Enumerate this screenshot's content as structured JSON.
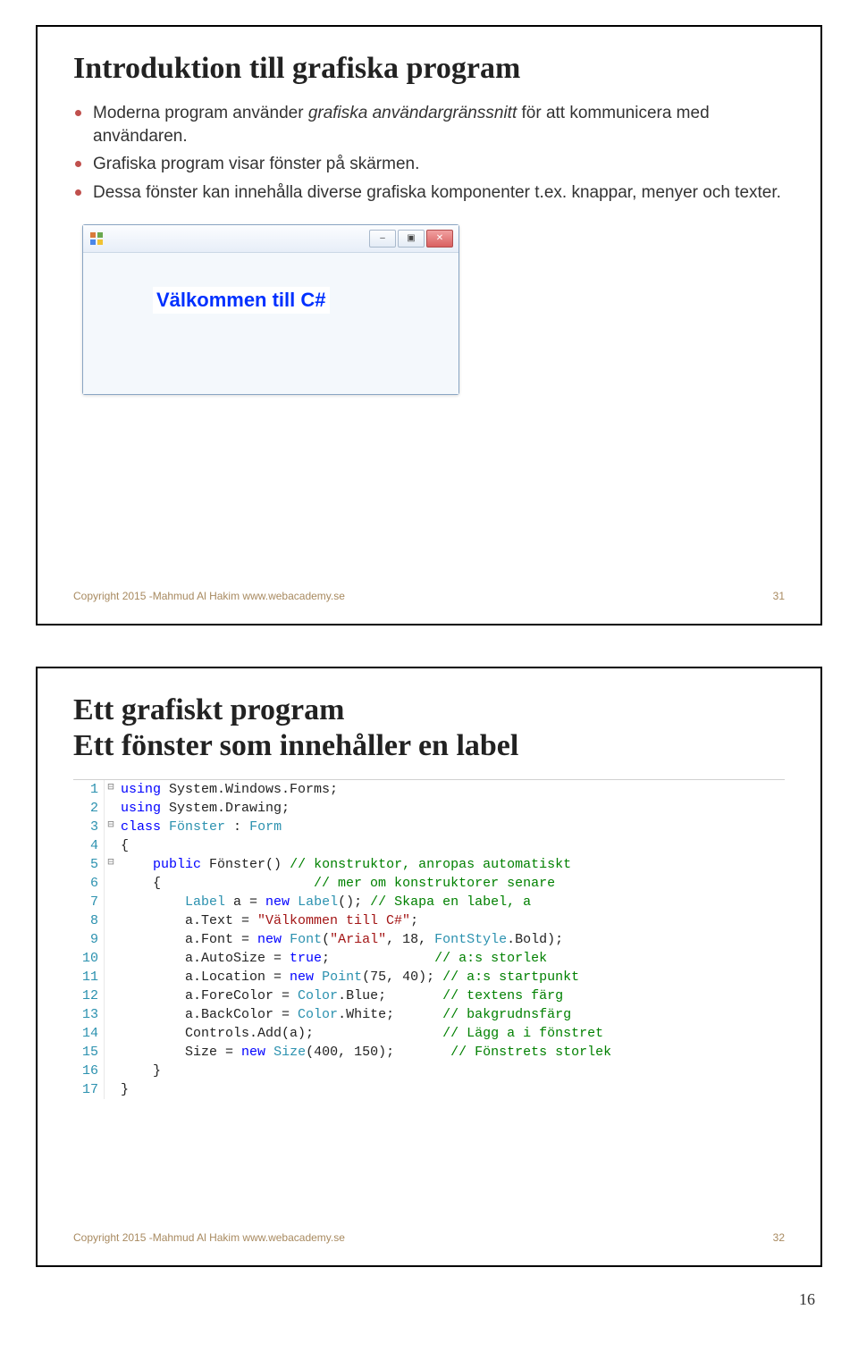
{
  "page_number": "16",
  "slide1": {
    "title": "Introduktion till grafiska program",
    "bullets": [
      {
        "pre": "Moderna program använder ",
        "em": "grafiska användargränssnitt",
        "post": " för att kommunicera med användaren."
      },
      {
        "pre": "Grafiska program visar fönster på skärmen.",
        "em": "",
        "post": ""
      },
      {
        "pre": "Dessa fönster kan innehålla diverse grafiska komponenter t.ex. knappar, menyer och texter.",
        "em": "",
        "post": ""
      }
    ],
    "window": {
      "title": "",
      "min_glyph": "–",
      "max_glyph": "▣",
      "close_glyph": "✕",
      "label_text": "Välkommen till C#"
    },
    "footer_left": "Copyright 2015 -Mahmud Al Hakim  www.webacademy.se",
    "footer_right": "31"
  },
  "slide2": {
    "title_line1": "Ett grafiskt program",
    "title_line2": "Ett fönster som innehåller en label",
    "code": [
      {
        "n": "1",
        "g": "⊟",
        "tokens": [
          {
            "c": "kw",
            "t": "using"
          },
          {
            "c": "",
            "t": " System.Windows.Forms;"
          }
        ]
      },
      {
        "n": "2",
        "g": "",
        "tokens": [
          {
            "c": "kw",
            "t": "using"
          },
          {
            "c": "",
            "t": " System.Drawing;"
          }
        ]
      },
      {
        "n": "3",
        "g": "⊟",
        "tokens": [
          {
            "c": "kw",
            "t": "class"
          },
          {
            "c": "",
            "t": " "
          },
          {
            "c": "type",
            "t": "Fönster"
          },
          {
            "c": "",
            "t": " : "
          },
          {
            "c": "type",
            "t": "Form"
          }
        ]
      },
      {
        "n": "4",
        "g": "",
        "tokens": [
          {
            "c": "",
            "t": "{"
          }
        ]
      },
      {
        "n": "5",
        "g": "⊟",
        "tokens": [
          {
            "c": "",
            "t": "    "
          },
          {
            "c": "kw",
            "t": "public"
          },
          {
            "c": "",
            "t": " Fönster() "
          },
          {
            "c": "cmt",
            "t": "// konstruktor, anropas automatiskt"
          }
        ]
      },
      {
        "n": "6",
        "g": "",
        "tokens": [
          {
            "c": "",
            "t": "    {                   "
          },
          {
            "c": "cmt",
            "t": "// mer om konstruktorer senare"
          }
        ]
      },
      {
        "n": "7",
        "g": "",
        "tokens": [
          {
            "c": "",
            "t": "        "
          },
          {
            "c": "type",
            "t": "Label"
          },
          {
            "c": "",
            "t": " a = "
          },
          {
            "c": "kw",
            "t": "new"
          },
          {
            "c": "",
            "t": " "
          },
          {
            "c": "type",
            "t": "Label"
          },
          {
            "c": "",
            "t": "(); "
          },
          {
            "c": "cmt",
            "t": "// Skapa en label, a"
          }
        ]
      },
      {
        "n": "8",
        "g": "",
        "tokens": [
          {
            "c": "",
            "t": "        a.Text = "
          },
          {
            "c": "str",
            "t": "\"Välkommen till C#\""
          },
          {
            "c": "",
            "t": ";"
          }
        ]
      },
      {
        "n": "9",
        "g": "",
        "tokens": [
          {
            "c": "",
            "t": "        a.Font = "
          },
          {
            "c": "kw",
            "t": "new"
          },
          {
            "c": "",
            "t": " "
          },
          {
            "c": "type",
            "t": "Font"
          },
          {
            "c": "",
            "t": "("
          },
          {
            "c": "str",
            "t": "\"Arial\""
          },
          {
            "c": "",
            "t": ", 18, "
          },
          {
            "c": "type",
            "t": "FontStyle"
          },
          {
            "c": "",
            "t": ".Bold);"
          }
        ]
      },
      {
        "n": "10",
        "g": "",
        "tokens": [
          {
            "c": "",
            "t": "        a.AutoSize = "
          },
          {
            "c": "kw",
            "t": "true"
          },
          {
            "c": "",
            "t": ";             "
          },
          {
            "c": "cmt",
            "t": "// a:s storlek"
          }
        ]
      },
      {
        "n": "11",
        "g": "",
        "tokens": [
          {
            "c": "",
            "t": "        a.Location = "
          },
          {
            "c": "kw",
            "t": "new"
          },
          {
            "c": "",
            "t": " "
          },
          {
            "c": "type",
            "t": "Point"
          },
          {
            "c": "",
            "t": "(75, 40); "
          },
          {
            "c": "cmt",
            "t": "// a:s startpunkt"
          }
        ]
      },
      {
        "n": "12",
        "g": "",
        "tokens": [
          {
            "c": "",
            "t": "        a.ForeColor = "
          },
          {
            "c": "type",
            "t": "Color"
          },
          {
            "c": "",
            "t": ".Blue;       "
          },
          {
            "c": "cmt",
            "t": "// textens färg"
          }
        ]
      },
      {
        "n": "13",
        "g": "",
        "tokens": [
          {
            "c": "",
            "t": "        a.BackColor = "
          },
          {
            "c": "type",
            "t": "Color"
          },
          {
            "c": "",
            "t": ".White;      "
          },
          {
            "c": "cmt",
            "t": "// bakgrudnsfärg"
          }
        ]
      },
      {
        "n": "14",
        "g": "",
        "tokens": [
          {
            "c": "",
            "t": "        Controls.Add(a);                "
          },
          {
            "c": "cmt",
            "t": "// Lägg a i fönstret"
          }
        ]
      },
      {
        "n": "15",
        "g": "",
        "tokens": [
          {
            "c": "",
            "t": "        Size = "
          },
          {
            "c": "kw",
            "t": "new"
          },
          {
            "c": "",
            "t": " "
          },
          {
            "c": "type",
            "t": "Size"
          },
          {
            "c": "",
            "t": "(400, 150);       "
          },
          {
            "c": "cmt",
            "t": "// Fönstrets storlek"
          }
        ]
      },
      {
        "n": "16",
        "g": "",
        "tokens": [
          {
            "c": "",
            "t": "    }"
          }
        ]
      },
      {
        "n": "17",
        "g": "",
        "tokens": [
          {
            "c": "",
            "t": "}"
          }
        ]
      }
    ],
    "footer_left": "Copyright 2015 -Mahmud Al Hakim  www.webacademy.se",
    "footer_right": "32"
  }
}
